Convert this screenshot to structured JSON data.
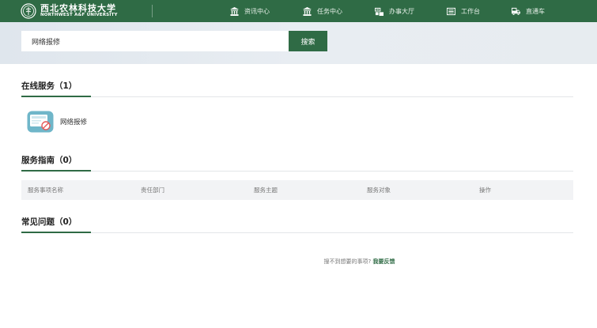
{
  "header": {
    "logo": {
      "name_cn": "西北农林科技大学",
      "name_en": "NORTHWEST A&F UNIVERSITY"
    },
    "nav": [
      {
        "label": "资讯中心",
        "icon": "institution-icon"
      },
      {
        "label": "任务中心",
        "icon": "institution-icon"
      },
      {
        "label": "办事大厅",
        "icon": "service-hall-icon"
      },
      {
        "label": "工作台",
        "icon": "workbench-icon"
      },
      {
        "label": "直通车",
        "icon": "express-icon"
      }
    ]
  },
  "search": {
    "value": "网络报修",
    "button_label": "搜索"
  },
  "online_services": {
    "title": "在线服务（1）",
    "items": [
      {
        "label": "网络报修",
        "icon": "network-repair-icon"
      }
    ]
  },
  "service_guide": {
    "title": "服务指南（0）",
    "columns": [
      "服务事项名称",
      "责任部门",
      "服务主题",
      "服务对象",
      "操作"
    ]
  },
  "faq": {
    "title": "常见问题（0）"
  },
  "feedback": {
    "prompt": "搜不到想要的事项?",
    "link": "我要反馈"
  },
  "colors": {
    "brand_green": "#2f6b45",
    "search_band": "#e4e9ee",
    "table_header_bg": "#f2f3f5"
  }
}
